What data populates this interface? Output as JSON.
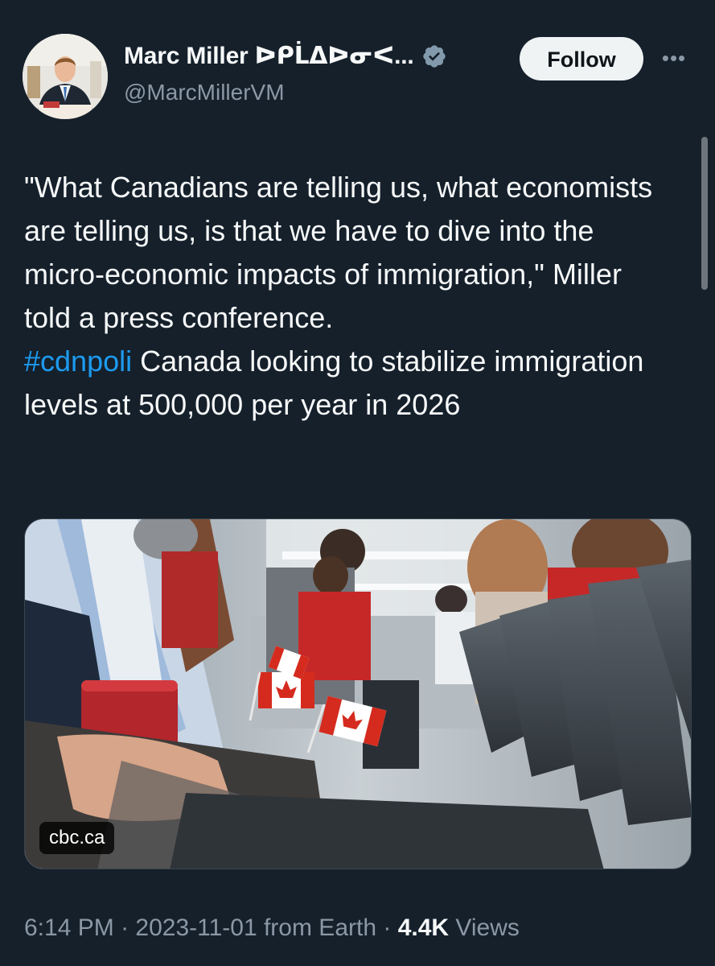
{
  "tweet": {
    "author": {
      "display_name": "Marc Miller ᐅᑭᒫᐃᐅᓂᐸ...",
      "handle": "@MarcMillerVM",
      "verified_icon": "verified-badge-icon"
    },
    "follow_label": "Follow",
    "more_label": "•••",
    "text": {
      "quote": "\"What Canadians are telling us, what economists are telling us, is that we have to dive into the micro-economic impacts of immigration,\" Miller told a press conference.",
      "hashtag": "#cdnpoli",
      "headline": "Canada looking to stabilize immigration levels at 500,000 per year in 2026"
    },
    "media": {
      "source": "cbc.ca"
    },
    "meta": {
      "time": "6:14 PM",
      "separator_1": " · ",
      "date": "2023-11-01",
      "location": " from Earth",
      "separator_2": " · ",
      "views_count": "4.4K",
      "views_label": " Views"
    }
  },
  "colors": {
    "background": "#15202b",
    "text_primary": "#f7f9f9",
    "text_secondary": "#8b98a5",
    "link": "#1d9bf0",
    "follow_bg": "#eff3f4"
  }
}
